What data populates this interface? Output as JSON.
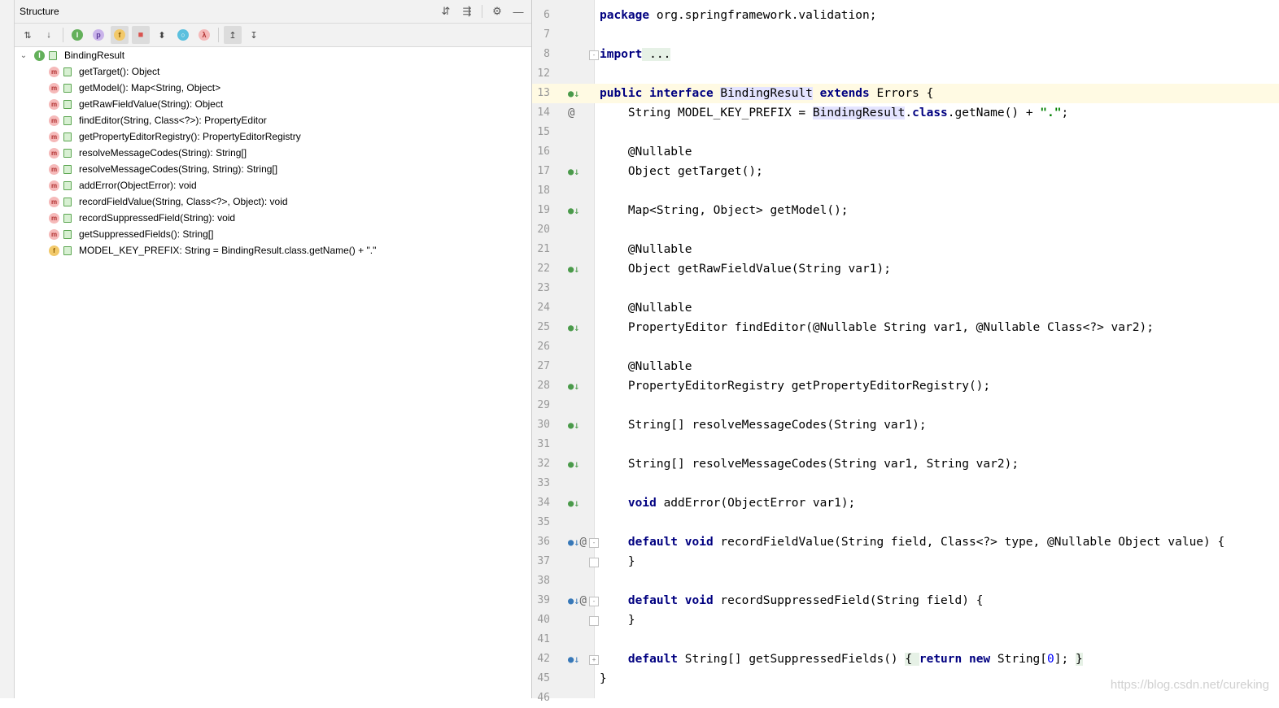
{
  "structure": {
    "title": "Structure",
    "root": {
      "label": "BindingResult",
      "icon": "interface-icon"
    },
    "members": [
      {
        "label": "getTarget(): Object",
        "kind": "method"
      },
      {
        "label": "getModel(): Map<String, Object>",
        "kind": "method"
      },
      {
        "label": "getRawFieldValue(String): Object",
        "kind": "method"
      },
      {
        "label": "findEditor(String, Class<?>): PropertyEditor",
        "kind": "method"
      },
      {
        "label": "getPropertyEditorRegistry(): PropertyEditorRegistry",
        "kind": "method"
      },
      {
        "label": "resolveMessageCodes(String): String[]",
        "kind": "method"
      },
      {
        "label": "resolveMessageCodes(String, String): String[]",
        "kind": "method"
      },
      {
        "label": "addError(ObjectError): void",
        "kind": "method"
      },
      {
        "label": "recordFieldValue(String, Class<?>, Object): void",
        "kind": "method"
      },
      {
        "label": "recordSuppressedField(String): void",
        "kind": "method"
      },
      {
        "label": "getSuppressedFields(): String[]",
        "kind": "method"
      },
      {
        "label": "MODEL_KEY_PREFIX: String = BindingResult.class.getName() + \".\"",
        "kind": "field"
      }
    ]
  },
  "editor": {
    "lines": [
      {
        "num": "6"
      },
      {
        "num": "7"
      },
      {
        "num": "8"
      },
      {
        "num": "12"
      },
      {
        "num": "13"
      },
      {
        "num": "14"
      },
      {
        "num": "15"
      },
      {
        "num": "16"
      },
      {
        "num": "17"
      },
      {
        "num": "18"
      },
      {
        "num": "19"
      },
      {
        "num": "20"
      },
      {
        "num": "21"
      },
      {
        "num": "22"
      },
      {
        "num": "23"
      },
      {
        "num": "24"
      },
      {
        "num": "25"
      },
      {
        "num": "26"
      },
      {
        "num": "27"
      },
      {
        "num": "28"
      },
      {
        "num": "29"
      },
      {
        "num": "30"
      },
      {
        "num": "31"
      },
      {
        "num": "32"
      },
      {
        "num": "33"
      },
      {
        "num": "34"
      },
      {
        "num": "35"
      },
      {
        "num": "36"
      },
      {
        "num": "37"
      },
      {
        "num": "38"
      },
      {
        "num": "39"
      },
      {
        "num": "40"
      },
      {
        "num": "41"
      },
      {
        "num": "42"
      },
      {
        "num": "45"
      },
      {
        "num": "46"
      }
    ],
    "code": {
      "l6_kw": "package",
      "l6_rest": " org.springframework.validation;",
      "l8_kw": "import",
      "l8_rest": " ...",
      "l13_a": "public interface",
      "l13_b": " ",
      "l13_c": "BindingResult",
      "l13_d": " ",
      "l13_e": "extends",
      "l13_f": " Errors {",
      "l14_a": "    String MODEL_KEY_PREFIX = ",
      "l14_b": "BindingResult",
      "l14_c": ".",
      "l14_d": "class",
      "l14_e": ".getName() + ",
      "l14_f": "\".\"",
      "l14_g": ";",
      "l16": "    @Nullable",
      "l17": "    Object getTarget();",
      "l19": "    Map<String, Object> getModel();",
      "l21": "    @Nullable",
      "l22": "    Object getRawFieldValue(String var1);",
      "l24": "    @Nullable",
      "l25": "    PropertyEditor findEditor(@Nullable String var1, @Nullable Class<?> var2);",
      "l27": "    @Nullable",
      "l28": "    PropertyEditorRegistry getPropertyEditorRegistry();",
      "l30": "    String[] resolveMessageCodes(String var1);",
      "l32": "    String[] resolveMessageCodes(String var1, String var2);",
      "l34_a": "    ",
      "l34_b": "void",
      "l34_c": " addError(ObjectError var1);",
      "l36_a": "    ",
      "l36_b": "default void",
      "l36_c": " recordFieldValue(String field, Class<?> type, @Nullable Object value) {",
      "l37": "    }",
      "l39_a": "    ",
      "l39_b": "default void",
      "l39_c": " recordSuppressedField(String field) {",
      "l40": "    }",
      "l42_a": "    ",
      "l42_b": "default",
      "l42_c": " String[] getSuppressedFields() ",
      "l42_d": "{ ",
      "l42_e": "return new",
      "l42_f": " String[",
      "l42_g": "0",
      "l42_h": "]; ",
      "l42_i": "}",
      "l45": "}"
    }
  },
  "watermark": "https://blog.csdn.net/cureking"
}
